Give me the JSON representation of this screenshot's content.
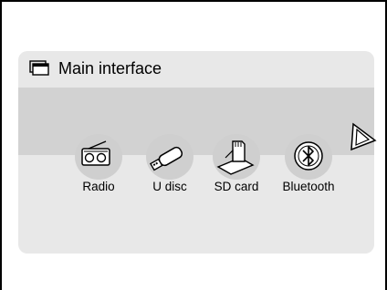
{
  "header": {
    "title": "Main interface",
    "icon": "window-stack-icon"
  },
  "menu": {
    "items": [
      {
        "label": "Radio",
        "icon": "radio-icon"
      },
      {
        "label": "U disc",
        "icon": "usb-drive-icon"
      },
      {
        "label": "SD card",
        "icon": "sd-card-icon"
      },
      {
        "label": "Bluetooth",
        "icon": "bluetooth-icon"
      }
    ],
    "next_icon": "next-arrow-icon"
  },
  "colors": {
    "panel": "#e8e8e8",
    "band": "#d2d2d2",
    "icon_bubble": "#cfcfcf",
    "border": "#000000"
  }
}
